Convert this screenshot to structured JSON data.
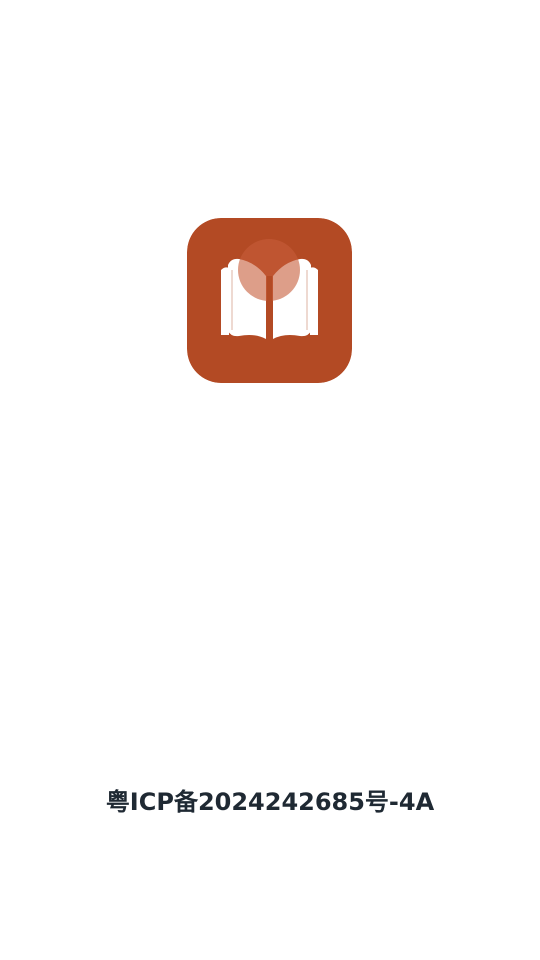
{
  "splash": {
    "icp_number": "粤ICP备2024242685号-4A"
  },
  "icons": {
    "logo": "open-book-logo-icon"
  },
  "colors": {
    "background": "#ffffff",
    "logo_bg": "#B34A24",
    "logo_page": "#ffffff",
    "logo_circle": "#DDA08A",
    "text": "#1f2933"
  }
}
